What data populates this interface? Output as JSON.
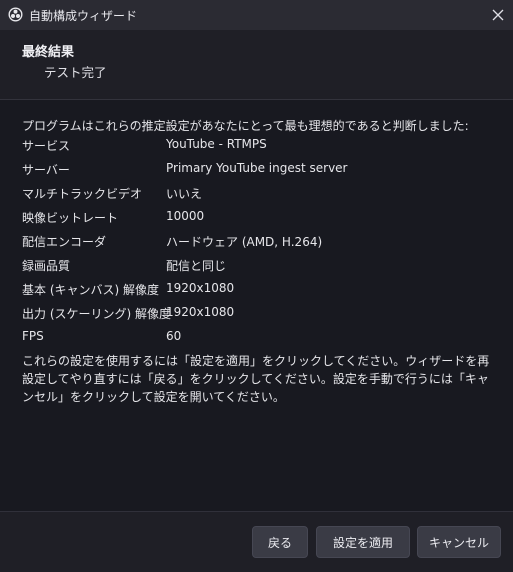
{
  "window": {
    "title": "自動構成ウィザード",
    "app_icon": "obs-logo-icon",
    "close_icon": "close-icon"
  },
  "header": {
    "title": "最終結果",
    "subtitle": "テスト完了"
  },
  "main": {
    "intro": "プログラムはこれらの推定設定があなたにとって最も理想的であると判断しました:",
    "settings": [
      {
        "label": "サービス",
        "value": "YouTube - RTMPS"
      },
      {
        "label": "サーバー",
        "value": "Primary YouTube ingest server"
      },
      {
        "label": "マルチトラックビデオ",
        "value": "いいえ"
      },
      {
        "label": "映像ビットレート",
        "value": "10000"
      },
      {
        "label": "配信エンコーダ",
        "value": "ハードウェア (AMD, H.264)"
      },
      {
        "label": "録画品質",
        "value": "配信と同じ"
      },
      {
        "label": "基本 (キャンバス) 解像度",
        "value": "1920x1080"
      },
      {
        "label": "出力 (スケーリング) 解像度",
        "value": "1920x1080"
      },
      {
        "label": "FPS",
        "value": "60"
      }
    ],
    "note": "これらの設定を使用するには「設定を適用」をクリックしてください。ウィザードを再設定してやり直すには「戻る」をクリックしてください。設定を手動で行うには「キャンセル」をクリックして設定を開いてください。"
  },
  "footer": {
    "back_label": "戻る",
    "apply_label": "設定を適用",
    "cancel_label": "キャンセル"
  },
  "colors": {
    "window_bg": "#1f1f26",
    "content_bg": "#181920",
    "titlebar_bg": "#2b2b33",
    "button_bg": "#3a3b45"
  }
}
